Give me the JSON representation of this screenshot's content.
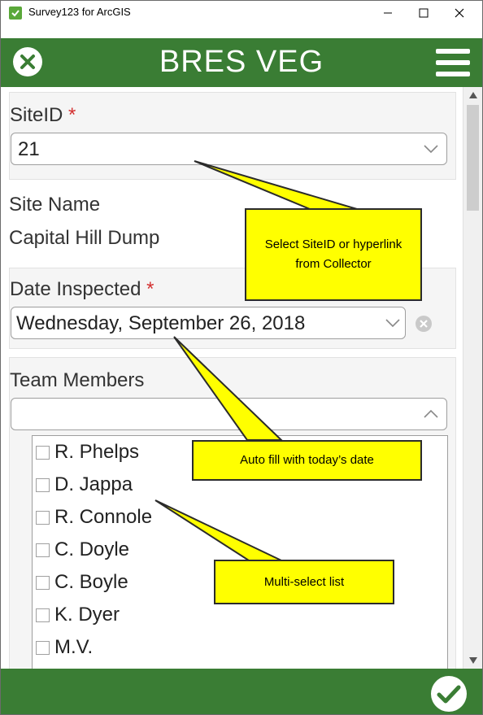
{
  "window": {
    "title": "Survey123 for ArcGIS",
    "minimize": "—",
    "maximize": "☐",
    "close": "✕"
  },
  "header": {
    "title": "BRES VEG"
  },
  "form": {
    "site_id": {
      "label": "SiteID",
      "required_mark": "*",
      "value": "21"
    },
    "site_name": {
      "label": "Site Name",
      "value": "Capital Hill Dump"
    },
    "date_inspected": {
      "label": "Date Inspected",
      "required_mark": "*",
      "value": "Wednesday, September 26, 2018"
    },
    "team_members": {
      "label": "Team Members",
      "filter_value": "",
      "options": [
        "R. Phelps",
        "D. Jappa",
        "R. Connole",
        "C. Doyle",
        "C. Boyle",
        "K. Dyer",
        "M.V."
      ]
    }
  },
  "callouts": {
    "select_site": "Select SiteID or hyperlink from Collector",
    "auto_fill": "Auto fill with today’s date",
    "multi_select": "Multi-select list"
  },
  "colors": {
    "brand_green": "#3a7d34",
    "required_red": "#d32f2f",
    "callout_yellow": "#ffff00"
  },
  "icons": {
    "app": "survey123-icon",
    "close_form": "close-circle-icon",
    "menu": "hamburger-menu-icon",
    "submit": "checkmark-circle-icon",
    "dropdown": "chevron-down-icon",
    "collapse": "chevron-up-icon",
    "clear_date": "clear-x-icon"
  }
}
